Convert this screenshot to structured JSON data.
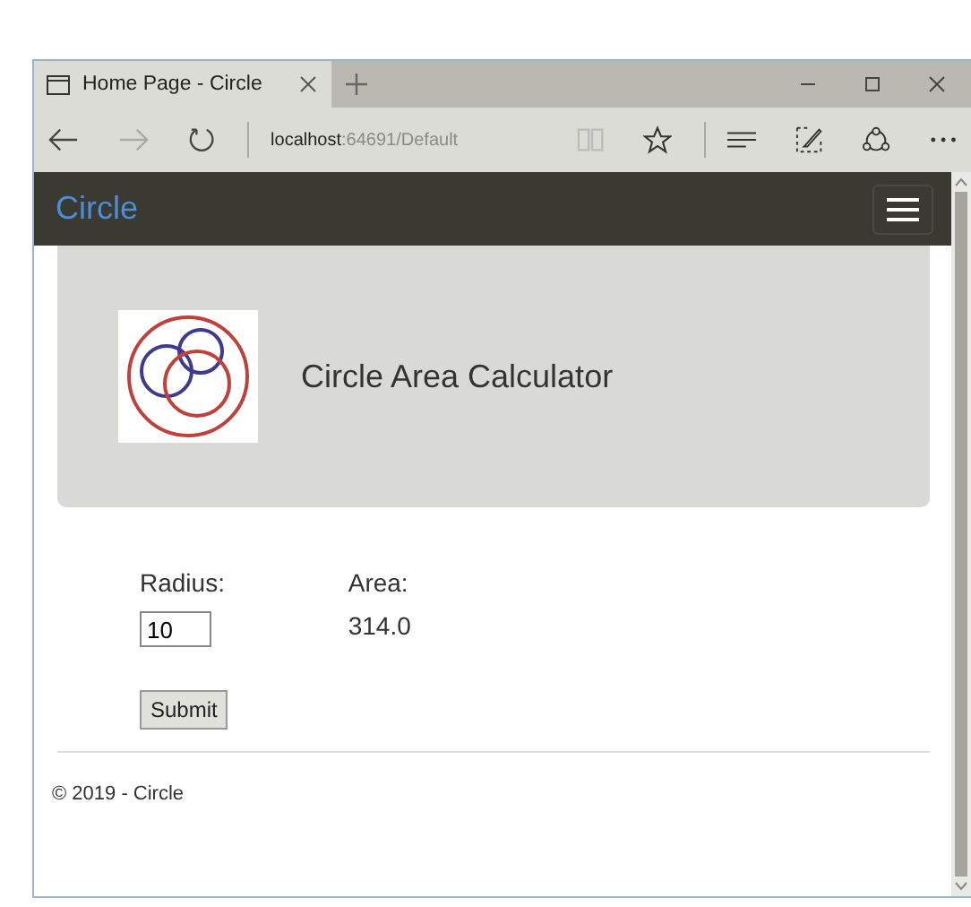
{
  "browser": {
    "tab_title": "Home Page - Circle",
    "url_host": "localhost",
    "url_path": ":64691/Default"
  },
  "navbar": {
    "brand": "Circle"
  },
  "header": {
    "title": "Circle Area Calculator"
  },
  "form": {
    "radius_label": "Radius:",
    "radius_value": "10",
    "area_label": "Area:",
    "area_value": "314.0",
    "submit": "Submit"
  },
  "footer": {
    "text": "© 2019 - Circle"
  }
}
